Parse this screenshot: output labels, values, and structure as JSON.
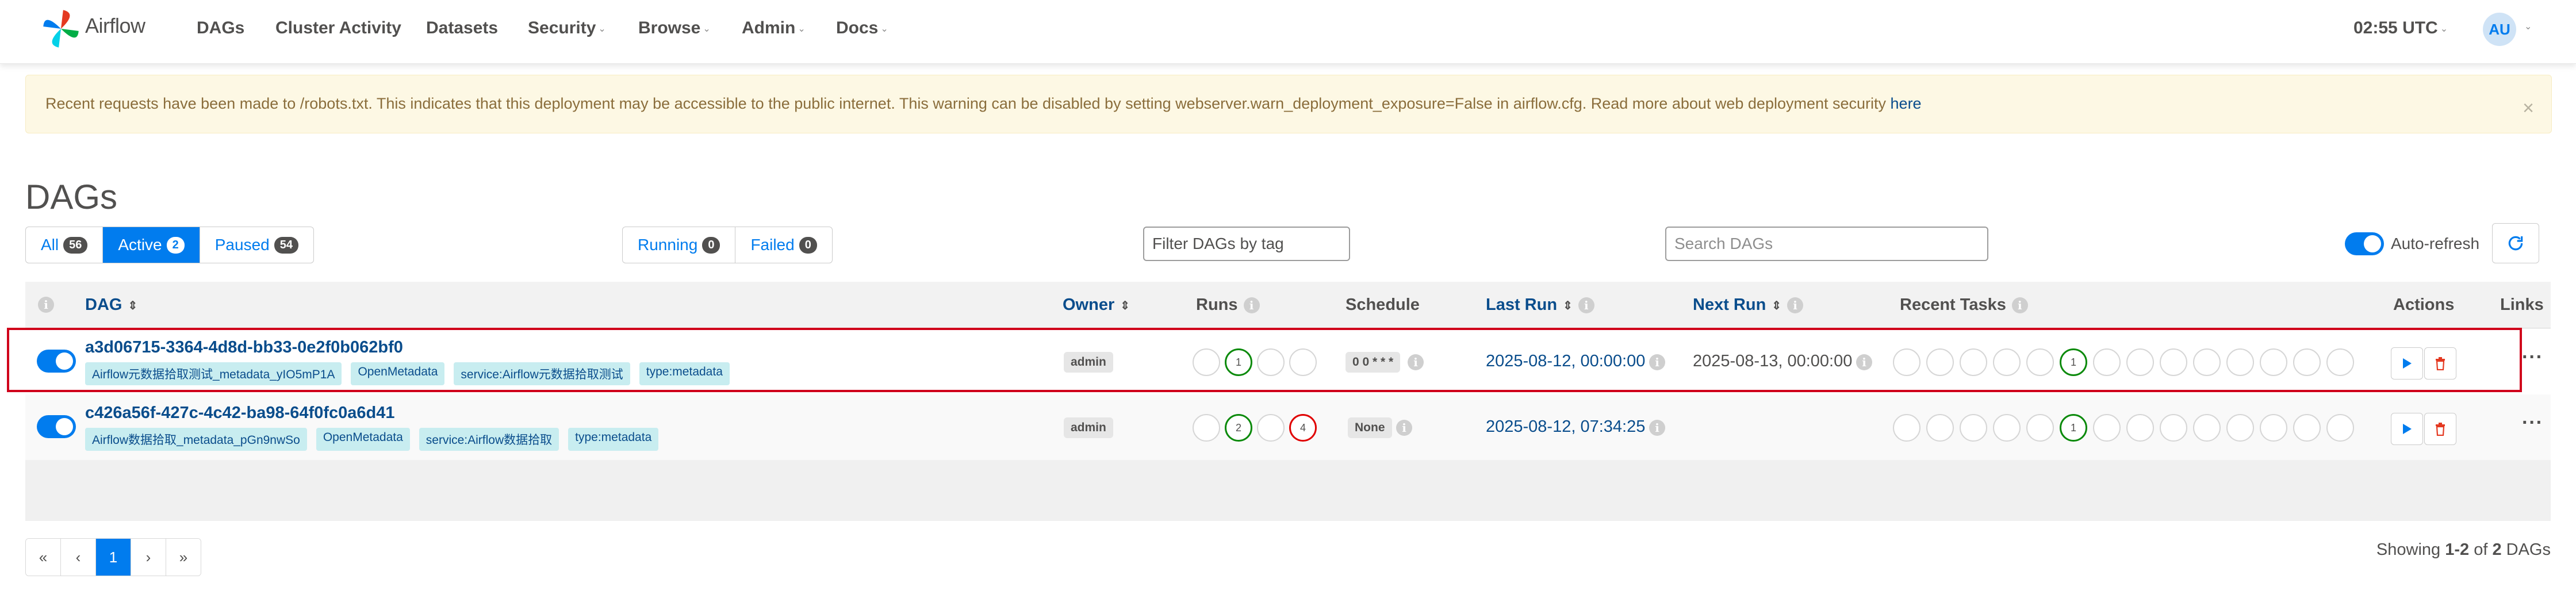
{
  "nav": {
    "brand": "Airflow",
    "items": [
      {
        "label": "DAGs",
        "dropdown": false
      },
      {
        "label": "Cluster Activity",
        "dropdown": false
      },
      {
        "label": "Datasets",
        "dropdown": false
      },
      {
        "label": "Security",
        "dropdown": true
      },
      {
        "label": "Browse",
        "dropdown": true
      },
      {
        "label": "Admin",
        "dropdown": true
      },
      {
        "label": "Docs",
        "dropdown": true
      }
    ],
    "clock": "02:55 UTC",
    "user_initials": "AU"
  },
  "alert": {
    "text": "Recent requests have been made to /robots.txt. This indicates that this deployment may be accessible to the public internet. This warning can be disabled by setting webserver.warn_deployment_exposure=False in airflow.cfg. Read more about web deployment security ",
    "link": "here"
  },
  "page_title": "DAGs",
  "status_filter": [
    {
      "label": "All",
      "count": "56"
    },
    {
      "label": "Active",
      "count": "2"
    },
    {
      "label": "Paused",
      "count": "54"
    }
  ],
  "run_filter": [
    {
      "label": "Running",
      "count": "0"
    },
    {
      "label": "Failed",
      "count": "0"
    }
  ],
  "tag_filter_placeholder": "Filter DAGs by tag",
  "search_placeholder": "Search DAGs",
  "auto_refresh_label": "Auto-refresh",
  "columns": {
    "dag": "DAG",
    "owner": "Owner",
    "runs": "Runs",
    "schedule": "Schedule",
    "last_run": "Last Run",
    "next_run": "Next Run",
    "recent_tasks": "Recent Tasks",
    "actions": "Actions",
    "links": "Links"
  },
  "rows": [
    {
      "dag_id": "a3d06715-3364-4d8d-bb33-0e2f0b062bf0",
      "tags": [
        "Airflow元数据拾取测试_metadata_yIO5mP1A",
        "OpenMetadata",
        "service:Airflow元数据拾取测试",
        "type:metadata"
      ],
      "owner": "admin",
      "runs": [
        "",
        "1",
        "",
        ""
      ],
      "schedule": "0 0 * * *",
      "last_run": "2025-08-12, 00:00:00",
      "next_run": "2025-08-13, 00:00:00",
      "recent_tasks_count": "1"
    },
    {
      "dag_id": "c426a56f-427c-4c42-ba98-64f0fc0a6d41",
      "tags": [
        "Airflow数据拾取_metadata_pGn9nwSo",
        "OpenMetadata",
        "service:Airflow数据拾取",
        "type:metadata"
      ],
      "owner": "admin",
      "runs": [
        "",
        "2",
        "",
        "4"
      ],
      "schedule": "None",
      "last_run": "2025-08-12, 07:34:25",
      "next_run": "",
      "recent_tasks_count": "1"
    }
  ],
  "pagination": [
    "«",
    "‹",
    "1",
    "›",
    "»"
  ],
  "showing": {
    "prefix": "Showing ",
    "range": "1-2",
    "of": " of ",
    "total": "2",
    "suffix": " DAGs"
  },
  "colors": {
    "primary": "#017cee",
    "success": "#0b8a0b",
    "failed": "#e00000",
    "highlight": "#d0021b"
  }
}
